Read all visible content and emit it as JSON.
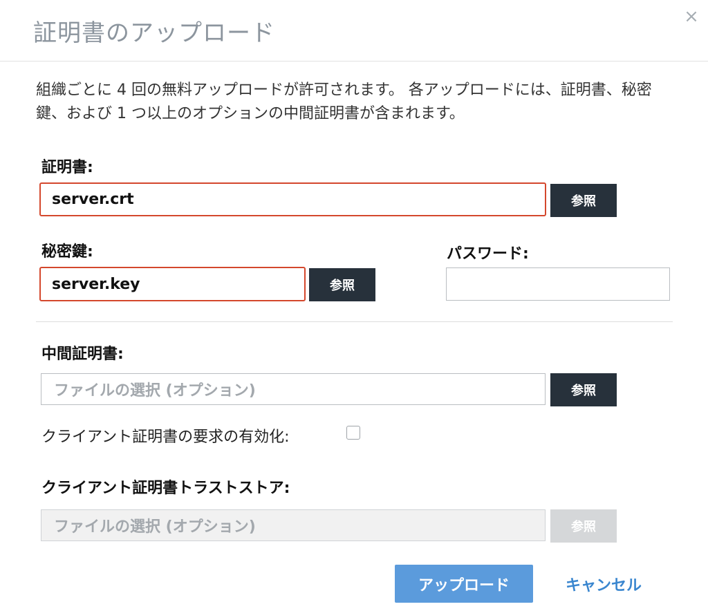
{
  "dialog": {
    "title": "証明書のアップロード",
    "close_glyph": "×",
    "description": "組織ごとに 4 回の無料アップロードが許可されます。 各アップロードには、証明書、秘密鍵、および 1 つ以上のオプションの中間証明書が含まれます。"
  },
  "certificate": {
    "label": "証明書:",
    "value": "server.crt",
    "browse_label": "参照"
  },
  "private_key": {
    "label": "秘密鍵:",
    "value": "server.key",
    "browse_label": "参照"
  },
  "password": {
    "label": "パスワード:",
    "value": ""
  },
  "intermediate": {
    "label": "中間証明書:",
    "placeholder": "ファイルの選択 (オプション)",
    "browse_label": "参照"
  },
  "client_cert_request": {
    "label": "クライアント証明書の要求の有効化:",
    "checked": false
  },
  "truststore": {
    "label": "クライアント証明書トラストストア:",
    "placeholder": "ファイルの選択 (オプション)",
    "browse_label": "参照",
    "disabled": true
  },
  "footer": {
    "upload_label": "アップロード",
    "cancel_label": "キャンセル"
  },
  "colors": {
    "error_border": "#d4472c",
    "browse_button": "#27313b",
    "primary_button": "#5b9bdc",
    "cancel_link": "#3a86cf"
  }
}
